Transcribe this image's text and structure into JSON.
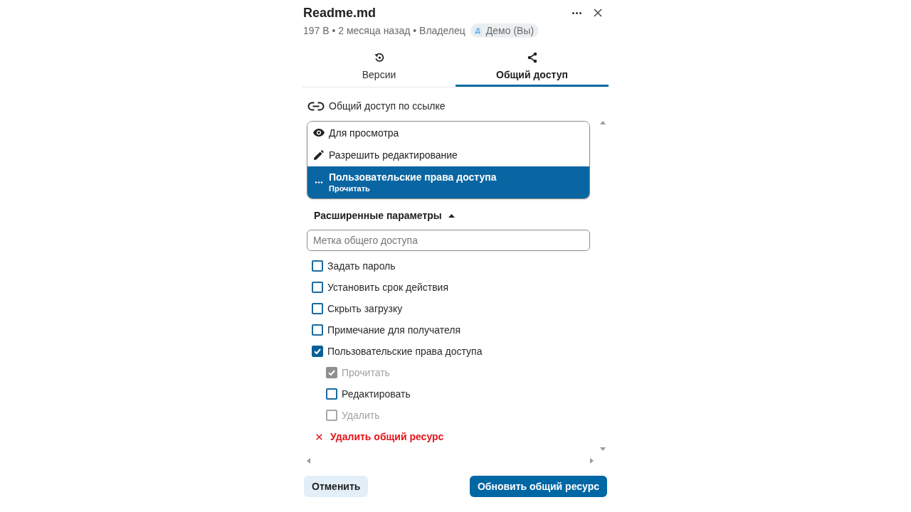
{
  "panel": {
    "title": "Readme.md",
    "meta": "197 B • 2 месяца назад • Владелец",
    "owner": {
      "initial": "Д",
      "name": "Демо (Вы)"
    }
  },
  "tabs": [
    {
      "kind": "versions",
      "label": "Версии",
      "selected": false
    },
    {
      "kind": "share",
      "label": "Общий доступ",
      "selected": true
    }
  ],
  "link_sharing": {
    "heading": "Общий доступ по ссылке",
    "options": [
      {
        "kind": "view",
        "label": "Для просмотра",
        "selected": false
      },
      {
        "kind": "edit",
        "label": "Разрешить редактирование",
        "selected": false
      },
      {
        "kind": "custom",
        "label": "Пользовательские права доступа",
        "detail": "Прочитать",
        "selected": true
      }
    ]
  },
  "advanced": {
    "label": "Расширенные параметры",
    "expanded": true,
    "share_label": {
      "placeholder": "Метка общего доступа"
    },
    "options": [
      {
        "label": "Задать пароль",
        "checked": false
      },
      {
        "label": "Установить срок действия",
        "checked": false
      },
      {
        "label": "Скрыть загрузку",
        "checked": false
      },
      {
        "label": "Примечание для получателя",
        "checked": false
      },
      {
        "label": "Пользовательские права доступа",
        "checked": true,
        "children": [
          {
            "label": "Прочитать",
            "checked": true,
            "disabled": true
          },
          {
            "label": "Редактировать",
            "checked": false,
            "disabled": false
          },
          {
            "label": "Удалить",
            "checked": false,
            "disabled": true
          }
        ]
      }
    ]
  },
  "unshare": "Удалить общий ресурс",
  "buttons": [
    {
      "kind": "secondary",
      "label": "Отменить"
    },
    {
      "kind": "primary",
      "label": "Обновить общий ресурс"
    }
  ]
}
